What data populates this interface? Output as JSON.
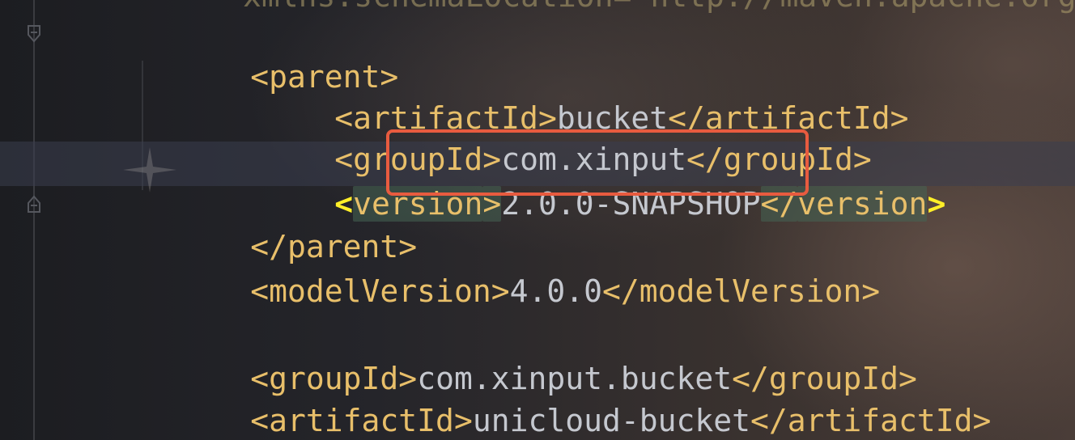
{
  "editor": {
    "lines": [
      {
        "tag_open": "<parent>"
      },
      {
        "tag_open": "<artifactId>",
        "value": "bucket",
        "tag_close": "</artifactId>"
      },
      {
        "tag_open": "<groupId>",
        "value": "com.xinput",
        "tag_close": "</groupId>"
      },
      {
        "tag_open_a": "<",
        "tag_open_b": "version",
        "tag_open_c": ">",
        "value": "2.0.0-SNAPSHOP",
        "tag_close_a": "</",
        "tag_close_b": "version",
        "tag_close_c": ">"
      },
      {
        "tag_close": "</parent>"
      },
      {
        "tag_open": "<modelVersion>",
        "value": "4.0.0",
        "tag_close": "</modelVersion>"
      },
      {
        "tag_open": "<groupId>",
        "value": "com.xinput.bucket",
        "tag_close": "</groupId>"
      },
      {
        "tag_open": "<artifactId>",
        "value": "unicloud-bucket",
        "tag_close": "</artifactId>"
      }
    ],
    "fold_icons": [
      "fold-open-icon",
      "fold-close-icon"
    ],
    "colors": {
      "tag": "#e8bf6a",
      "tag_bright": "#ffef28",
      "text": "#c5c8cf",
      "selection_box": "#e85b3f"
    }
  }
}
